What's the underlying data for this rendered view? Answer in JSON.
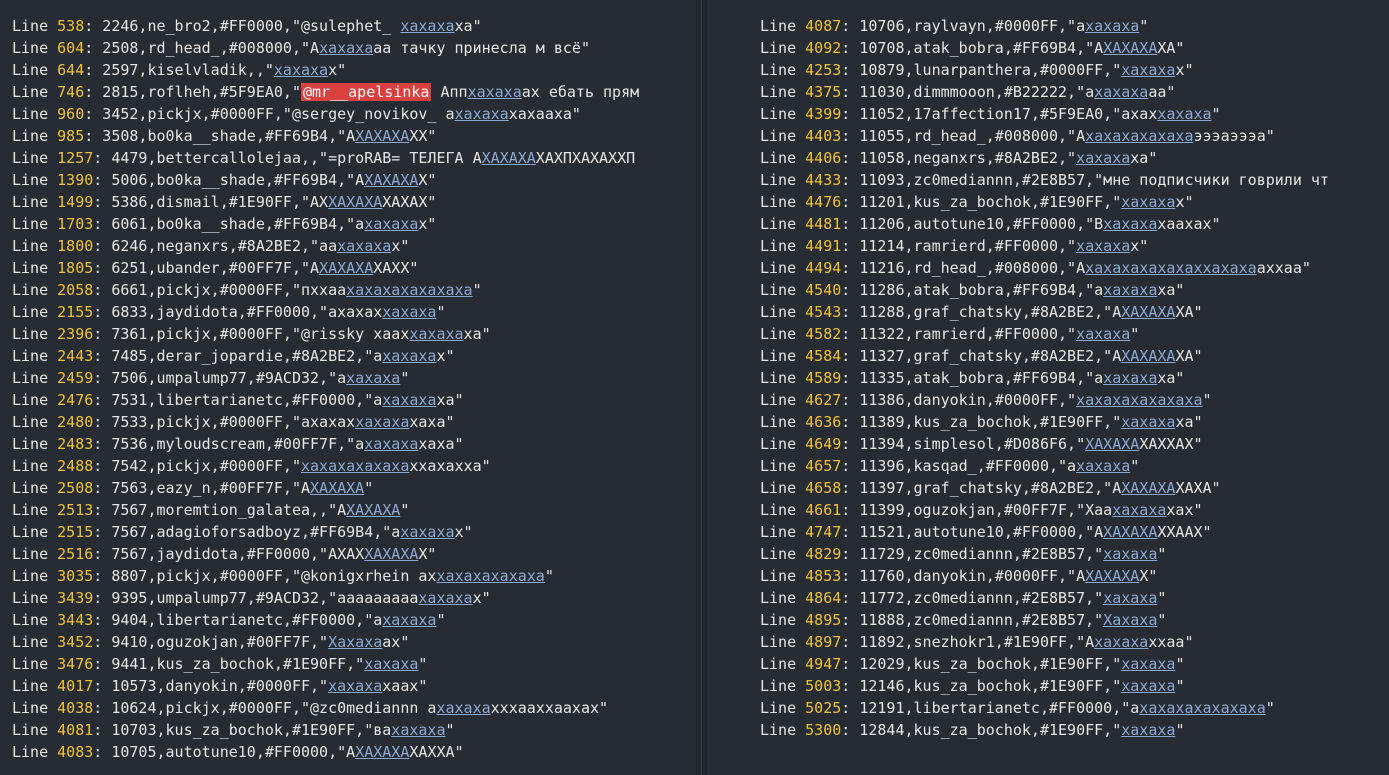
{
  "colors": {
    "background": "#272c32",
    "line_number": "#f0c23a",
    "match": "#8ba9d6",
    "highlight": "#d94040"
  },
  "keyword": "Line",
  "left": [
    {
      "n": "538",
      "s": [
        [
          ": 2246,ne_bro2,#FF0000,\"@sulephet_ ",
          ""
        ],
        [
          "хахаха",
          "m"
        ],
        [
          "ха\"",
          ""
        ]
      ]
    },
    {
      "n": "604",
      "s": [
        [
          ": 2508,rd_head_,#008000,\"А",
          ""
        ],
        [
          "хахаха",
          "m"
        ],
        [
          "аа тачку принесла м всё\"",
          ""
        ]
      ]
    },
    {
      "n": "644",
      "s": [
        [
          ": 2597,kiselvladik,,\"",
          ""
        ],
        [
          "хахаха",
          "m"
        ],
        [
          "х\"",
          ""
        ]
      ]
    },
    {
      "n": "746",
      "s": [
        [
          ": 2815,roflheh,#5F9EA0,\"",
          ""
        ],
        [
          "@mr__apelsinka",
          "hl"
        ],
        [
          " Апп",
          ""
        ],
        [
          "хахаха",
          "m"
        ],
        [
          "ах ебать прям",
          ""
        ]
      ]
    },
    {
      "n": "960",
      "s": [
        [
          ": 3452,pickjx,#0000FF,\"@sergey_novikov_ а",
          ""
        ],
        [
          "хахаха",
          "m"
        ],
        [
          "хахааха\"",
          ""
        ]
      ]
    },
    {
      "n": "985",
      "s": [
        [
          ": 3508,bo0ka__shade,#FF69B4,\"А",
          ""
        ],
        [
          "ХАХАХА",
          "m"
        ],
        [
          "ХХ\"",
          ""
        ]
      ]
    },
    {
      "n": "1257",
      "s": [
        [
          ": 4479,bettercallolejaa,,\"=proRAB= ТЕЛЕГА А",
          ""
        ],
        [
          "ХАХАХА",
          "m"
        ],
        [
          "ХАХПХАХАХХП",
          ""
        ]
      ]
    },
    {
      "n": "1390",
      "s": [
        [
          ": 5006,bo0ka__shade,#FF69B4,\"А",
          ""
        ],
        [
          "ХАХАХА",
          "m"
        ],
        [
          "Х\"",
          ""
        ]
      ]
    },
    {
      "n": "1499",
      "s": [
        [
          ": 5386,dismail,#1E90FF,\"АХ",
          ""
        ],
        [
          "ХАХАХА",
          "m"
        ],
        [
          "ХАХАХ\"",
          ""
        ]
      ]
    },
    {
      "n": "1703",
      "s": [
        [
          ": 6061,bo0ka__shade,#FF69B4,\"а",
          ""
        ],
        [
          "хахаха",
          "m"
        ],
        [
          "х\"",
          ""
        ]
      ]
    },
    {
      "n": "1800",
      "s": [
        [
          ": 6246,neganxrs,#8A2BE2,\"аа",
          ""
        ],
        [
          "хахаха",
          "m"
        ],
        [
          "х\"",
          ""
        ]
      ]
    },
    {
      "n": "1805",
      "s": [
        [
          ": 6251,ubander,#00FF7F,\"А",
          ""
        ],
        [
          "ХАХАХА",
          "m"
        ],
        [
          "ХАХХ\"",
          ""
        ]
      ]
    },
    {
      "n": "2058",
      "s": [
        [
          ": 6661,pickjx,#0000FF,\"пхх",
          ""
        ],
        [
          "аа",
          ""
        ],
        [
          "хахахахахахаха",
          "m"
        ],
        [
          "\"",
          ""
        ]
      ]
    },
    {
      "n": "2155",
      "s": [
        [
          ": 6833,jaydidota,#FF0000,\"ахахах",
          ""
        ],
        [
          "хахаха",
          "m"
        ],
        [
          "\"",
          ""
        ]
      ]
    },
    {
      "n": "2396",
      "s": [
        [
          ": 7361,pickjx,#0000FF,\"@rissky хаах",
          ""
        ],
        [
          "хахаха",
          "m"
        ],
        [
          "ха\"",
          ""
        ]
      ]
    },
    {
      "n": "2443",
      "s": [
        [
          ": 7485,derar_jopardie,#8A2BE2,\"а",
          ""
        ],
        [
          "хахаха",
          "m"
        ],
        [
          "х\"",
          ""
        ]
      ]
    },
    {
      "n": "2459",
      "s": [
        [
          ": 7506,umpalump77,#9ACD32,\"а",
          ""
        ],
        [
          "хахаха",
          "m"
        ],
        [
          "\"",
          ""
        ]
      ]
    },
    {
      "n": "2476",
      "s": [
        [
          ": 7531,libertarianetc,#FF0000,\"а",
          ""
        ],
        [
          "хахаха",
          "m"
        ],
        [
          "ха\"",
          ""
        ]
      ]
    },
    {
      "n": "2480",
      "s": [
        [
          ": 7533,pickjx,#0000FF,\"ахахах",
          ""
        ],
        [
          "хахаха",
          "m"
        ],
        [
          "хаха\"",
          ""
        ]
      ]
    },
    {
      "n": "2483",
      "s": [
        [
          ": 7536,myloudscream,#00FF7F,\"а",
          ""
        ],
        [
          "хахаха",
          "m"
        ],
        [
          "хаха\"",
          ""
        ]
      ]
    },
    {
      "n": "2488",
      "s": [
        [
          ": 7542,pickjx,#0000FF,\"",
          ""
        ],
        [
          "хахахахахаха",
          "m"
        ],
        [
          "ххахахха\"",
          ""
        ]
      ]
    },
    {
      "n": "2508",
      "s": [
        [
          ": 7563,eazy_n,#00FF7F,\"А",
          ""
        ],
        [
          "ХАХАХА",
          "m"
        ],
        [
          "\"",
          ""
        ]
      ]
    },
    {
      "n": "2513",
      "s": [
        [
          ": 7567,moremtion_galatea,,\"А",
          ""
        ],
        [
          "ХАХАХА",
          "m"
        ],
        [
          "\"",
          ""
        ]
      ]
    },
    {
      "n": "2515",
      "s": [
        [
          ": 7567,adagioforsadboyz,#FF69B4,\"а",
          ""
        ],
        [
          "хахаха",
          "m"
        ],
        [
          "х\"",
          ""
        ]
      ]
    },
    {
      "n": "2516",
      "s": [
        [
          ": 7567,jaydidota,#FF0000,\"АХАХ",
          ""
        ],
        [
          "ХАХАХА",
          "m"
        ],
        [
          "Х\"",
          ""
        ]
      ]
    },
    {
      "n": "3035",
      "s": [
        [
          ": 8807,pickjx,#0000FF,\"@konigxrhein ах",
          ""
        ],
        [
          "хахахахахаха",
          "m"
        ],
        [
          "\"",
          ""
        ]
      ]
    },
    {
      "n": "3439",
      "s": [
        [
          ": 9395,umpalump77,#9ACD32,\"ааааааааа",
          ""
        ],
        [
          "хахаха",
          "m"
        ],
        [
          "х\"",
          ""
        ]
      ]
    },
    {
      "n": "3443",
      "s": [
        [
          ": 9404,libertarianetc,#FF0000,\"а",
          ""
        ],
        [
          "хахаха",
          "m"
        ],
        [
          "\"",
          ""
        ]
      ]
    },
    {
      "n": "3452",
      "s": [
        [
          ": 9410,oguzokjan,#00FF7F,\"",
          ""
        ],
        [
          "Хахаха",
          "m"
        ],
        [
          "ах\"",
          ""
        ]
      ]
    },
    {
      "n": "3476",
      "s": [
        [
          ": 9441,kus_za_bochok,#1E90FF,\"",
          ""
        ],
        [
          "хахаха",
          "m"
        ],
        [
          "\"",
          ""
        ]
      ]
    },
    {
      "n": "4017",
      "s": [
        [
          ": 10573,danyokin,#0000FF,\"",
          ""
        ],
        [
          "хахаха",
          "m"
        ],
        [
          "хаах\"",
          ""
        ]
      ]
    },
    {
      "n": "4038",
      "s": [
        [
          ": 10624,pickjx,#0000FF,\"@zc0mediannn а",
          ""
        ],
        [
          "хахаха",
          "m"
        ],
        [
          "хххааххаахах\"",
          ""
        ]
      ]
    },
    {
      "n": "4081",
      "s": [
        [
          ": 10703,kus_za_bochok,#1E90FF,\"ва",
          ""
        ],
        [
          "хахаха",
          "m"
        ],
        [
          "\"",
          ""
        ]
      ]
    },
    {
      "n": "4083",
      "s": [
        [
          ": 10705,autotune10,#FF0000,\"А",
          ""
        ],
        [
          "ХАХАХА",
          "m"
        ],
        [
          "ХАХХА\"",
          ""
        ]
      ]
    }
  ],
  "right": [
    {
      "n": "4087",
      "s": [
        [
          ": 10706,raylvayn,#0000FF,\"а",
          ""
        ],
        [
          "хахаха",
          "m"
        ],
        [
          "\"",
          ""
        ]
      ]
    },
    {
      "n": "4092",
      "s": [
        [
          ": 10708,atak_bobra,#FF69B4,\"А",
          ""
        ],
        [
          "ХАХАХА",
          "m"
        ],
        [
          "ХА\"",
          ""
        ]
      ]
    },
    {
      "n": "4253",
      "s": [
        [
          ": 10879,lunarpanthera,#0000FF,\"",
          ""
        ],
        [
          "хахаха",
          "m"
        ],
        [
          "х\"",
          ""
        ]
      ]
    },
    {
      "n": "4375",
      "s": [
        [
          ": 11030,dimmmooon,#B22222,\"а",
          ""
        ],
        [
          "хахаха",
          "m"
        ],
        [
          "аа\"",
          ""
        ]
      ]
    },
    {
      "n": "4399",
      "s": [
        [
          ": 11052,17affection17,#5F9EA0,\"ахах",
          ""
        ],
        [
          "хахаха",
          "m"
        ],
        [
          "\"",
          ""
        ]
      ]
    },
    {
      "n": "4403",
      "s": [
        [
          ": 11055,rd_head_,#008000,\"А",
          ""
        ],
        [
          "хахахахахаха",
          "m"
        ],
        [
          "эээаэээа\"",
          ""
        ]
      ]
    },
    {
      "n": "4406",
      "s": [
        [
          ": 11058,neganxrs,#8A2BE2,\"",
          ""
        ],
        [
          "хахаха",
          "m"
        ],
        [
          "ха\"",
          ""
        ]
      ]
    },
    {
      "n": "4433",
      "s": [
        [
          ": 11093,zc0mediannn,#2E8B57,\"мне подписчики говрили чт",
          ""
        ]
      ]
    },
    {
      "n": "4476",
      "s": [
        [
          ": 11201,kus_za_bochok,#1E90FF,\"",
          ""
        ],
        [
          "хахаха",
          "m"
        ],
        [
          "х\"",
          ""
        ]
      ]
    },
    {
      "n": "4481",
      "s": [
        [
          ": 11206,autotune10,#FF0000,\"В",
          ""
        ],
        [
          "хахаха",
          "m"
        ],
        [
          "хаахах\"",
          ""
        ]
      ]
    },
    {
      "n": "4491",
      "s": [
        [
          ": 11214,ramrierd,#FF0000,\"",
          ""
        ],
        [
          "хахаха",
          "m"
        ],
        [
          "х\"",
          ""
        ]
      ]
    },
    {
      "n": "4494",
      "s": [
        [
          ": 11216,rd_head_,#008000,\"А",
          ""
        ],
        [
          "хахахахахахаххахаха",
          "m"
        ],
        [
          "аххаа\"",
          ""
        ]
      ]
    },
    {
      "n": "4540",
      "s": [
        [
          ": 11286,atak_bobra,#FF69B4,\"а",
          ""
        ],
        [
          "хахаха",
          "m"
        ],
        [
          "ха\"",
          ""
        ]
      ]
    },
    {
      "n": "4543",
      "s": [
        [
          ": 11288,graf_chatsky,#8A2BE2,\"А",
          ""
        ],
        [
          "ХАХАХА",
          "m"
        ],
        [
          "ХА\"",
          ""
        ]
      ]
    },
    {
      "n": "4582",
      "s": [
        [
          ": 11322,ramrierd,#FF0000,\"",
          ""
        ],
        [
          "хахаха",
          "m"
        ],
        [
          "\"",
          ""
        ]
      ]
    },
    {
      "n": "4584",
      "s": [
        [
          ": 11327,graf_chatsky,#8A2BE2,\"А",
          ""
        ],
        [
          "ХАХАХА",
          "m"
        ],
        [
          "ХА\"",
          ""
        ]
      ]
    },
    {
      "n": "4589",
      "s": [
        [
          ": 11335,atak_bobra,#FF69B4,\"а",
          ""
        ],
        [
          "хахаха",
          "m"
        ],
        [
          "ха\"",
          ""
        ]
      ]
    },
    {
      "n": "4627",
      "s": [
        [
          ": 11386,danyokin,#0000FF,\"",
          ""
        ],
        [
          "хахахахахахаха",
          "m"
        ],
        [
          "\"",
          ""
        ]
      ]
    },
    {
      "n": "4636",
      "s": [
        [
          ": 11389,kus_za_bochok,#1E90FF,\"",
          ""
        ],
        [
          "хахаха",
          "m"
        ],
        [
          "ха\"",
          ""
        ]
      ]
    },
    {
      "n": "4649",
      "s": [
        [
          ": 11394,simplesol,#D086F6,\"",
          ""
        ],
        [
          "ХАХАХА",
          "m"
        ],
        [
          "ХАХХАХ\"",
          ""
        ]
      ]
    },
    {
      "n": "4657",
      "s": [
        [
          ": 11396,kasqad_,#FF0000,\"а",
          ""
        ],
        [
          "хахаха",
          "m"
        ],
        [
          "\"",
          ""
        ]
      ]
    },
    {
      "n": "4658",
      "s": [
        [
          ": 11397,graf_chatsky,#8A2BE2,\"А",
          ""
        ],
        [
          "ХАХАХА",
          "m"
        ],
        [
          "ХАХА\"",
          ""
        ]
      ]
    },
    {
      "n": "4661",
      "s": [
        [
          ": 11399,oguzokjan,#00FF7F,\"Хаа",
          ""
        ],
        [
          "хахаха",
          "m"
        ],
        [
          "хах\"",
          ""
        ]
      ]
    },
    {
      "n": "4747",
      "s": [
        [
          ": 11521,autotune10,#FF0000,\"А",
          ""
        ],
        [
          "ХАХАХА",
          "m"
        ],
        [
          "ХХААХ\"",
          ""
        ]
      ]
    },
    {
      "n": "4829",
      "s": [
        [
          ": 11729,zc0mediannn,#2E8B57,\"",
          ""
        ],
        [
          "хахаха",
          "m"
        ],
        [
          "\"",
          ""
        ]
      ]
    },
    {
      "n": "4853",
      "s": [
        [
          ": 11760,danyokin,#0000FF,\"А",
          ""
        ],
        [
          "ХАХАХА",
          "m"
        ],
        [
          "Х\"",
          ""
        ]
      ]
    },
    {
      "n": "4864",
      "s": [
        [
          ": 11772,zc0mediannn,#2E8B57,\"",
          ""
        ],
        [
          "хахаха",
          "m"
        ],
        [
          "\"",
          ""
        ]
      ]
    },
    {
      "n": "4895",
      "s": [
        [
          ": 11888,zc0mediannn,#2E8B57,\"",
          ""
        ],
        [
          "Хахаха",
          "m"
        ],
        [
          "\"",
          ""
        ]
      ]
    },
    {
      "n": "4897",
      "s": [
        [
          ": 11892,snezhokr1,#1E90FF,\"А",
          ""
        ],
        [
          "хахаха",
          "m"
        ],
        [
          "ххаа\"",
          ""
        ]
      ]
    },
    {
      "n": "4947",
      "s": [
        [
          ": 12029,kus_za_bochok,#1E90FF,\"",
          ""
        ],
        [
          "хахаха",
          "m"
        ],
        [
          "\"",
          ""
        ]
      ]
    },
    {
      "n": "5003",
      "s": [
        [
          ": 12146,kus_za_bochok,#1E90FF,\"",
          ""
        ],
        [
          "хахаха",
          "m"
        ],
        [
          "\"",
          ""
        ]
      ]
    },
    {
      "n": "5025",
      "s": [
        [
          ": 12191,libertarianetc,#FF0000,\"а",
          ""
        ],
        [
          "хахахахахахаха",
          "m"
        ],
        [
          "\"",
          ""
        ]
      ]
    },
    {
      "n": "5300",
      "s": [
        [
          ": 12844,kus_za_bochok,#1E90FF,\"",
          ""
        ],
        [
          "хахаха",
          "m"
        ],
        [
          "\"",
          ""
        ]
      ]
    }
  ]
}
